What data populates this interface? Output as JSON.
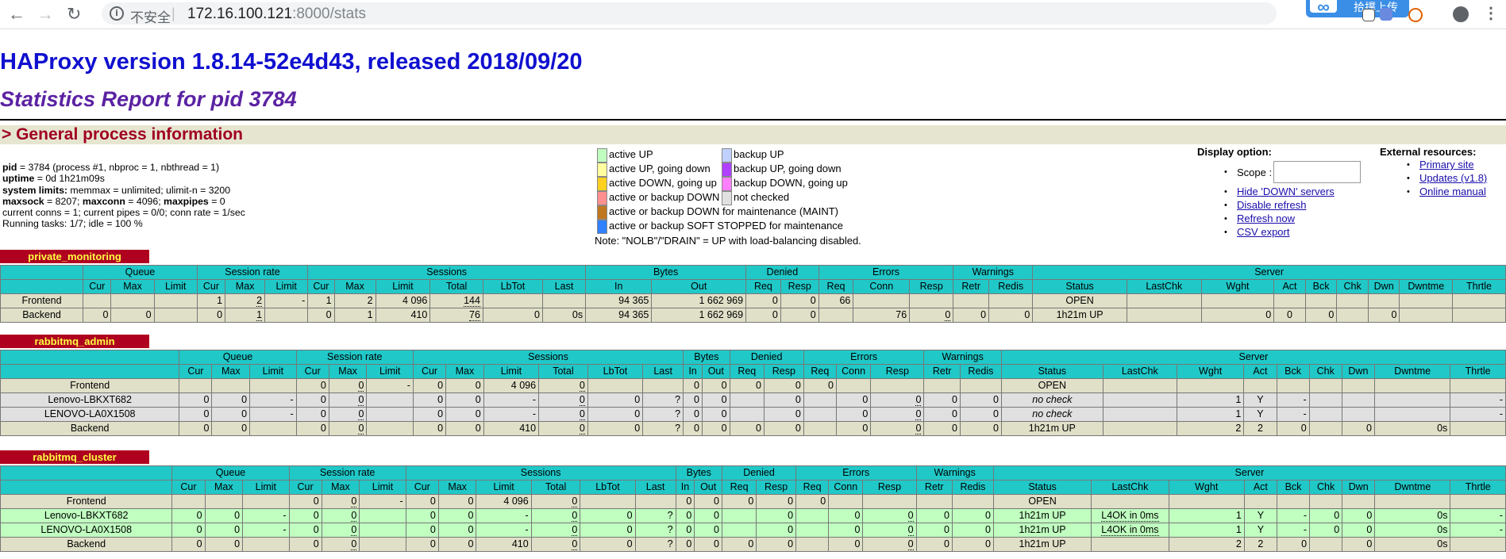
{
  "browser": {
    "security_label": "不安全",
    "url_host": "172.16.100.121",
    "url_rest": ":8000/stats",
    "upload_badge": "拾撲上传"
  },
  "page": {
    "title": "HAProxy version 1.8.14-52e4d43, released 2018/09/20",
    "subtitle": "Statistics Report for pid 3784",
    "section_header": "> General process information"
  },
  "procinfo": {
    "l1_key": "pid",
    "l1_val": " = 3784 (process #1, nbproc = 1, nbthread = 1)",
    "l2_key": "uptime",
    "l2_val": " = 0d 1h21m09s",
    "l3_key": "system limits:",
    "l3_val": " memmax = unlimited; ulimit-n = 3200",
    "l4_key": "maxsock",
    "l4_val": " = 8207; ",
    "l4_key2": "maxconn",
    "l4_val2": " = 4096; ",
    "l4_key3": "maxpipes",
    "l4_val3": " = 0",
    "l5": "current conns = 1; current pipes = 0/0; conn rate = 1/sec",
    "l6": "Running tasks: 1/7; idle = 100 %"
  },
  "legend": {
    "items": [
      {
        "label": "active UP",
        "color": "#c0ffc0"
      },
      {
        "label": "active UP, going down",
        "color": "#ffffa0"
      },
      {
        "label": "active DOWN, going up",
        "color": "#ffd020"
      },
      {
        "label": "active or backup DOWN",
        "color": "#ff9090"
      },
      {
        "label": "active or backup DOWN for maintenance (MAINT)",
        "color": "#c07820"
      },
      {
        "label": "active or backup SOFT STOPPED for maintenance",
        "color": "#3080ff"
      },
      {
        "label": "backup UP",
        "color": "#c0d0ff"
      },
      {
        "label": "backup UP, going down",
        "color": "#b040ff"
      },
      {
        "label": "backup DOWN, going up",
        "color": "#ff80ff"
      },
      {
        "label": "not checked",
        "color": "#e0e0e0"
      }
    ],
    "note": "Note: \"NOLB\"/\"DRAIN\" = UP with load-balancing disabled."
  },
  "display_options": {
    "title": "Display option:",
    "scope_label": "Scope :",
    "scope_value": "",
    "links": [
      "Hide 'DOWN' servers",
      "Disable refresh",
      "Refresh now",
      "CSV export"
    ]
  },
  "external_resources": {
    "title": "External resources:",
    "links": [
      "Primary site",
      "Updates (v1.8)",
      "Online manual"
    ]
  },
  "table_headers": {
    "groups": [
      "Queue",
      "Session rate",
      "Sessions",
      "Bytes",
      "Denied",
      "Errors",
      "Warnings",
      "Server"
    ],
    "cols": [
      "Cur",
      "Max",
      "Limit",
      "Cur",
      "Max",
      "Limit",
      "Cur",
      "Max",
      "Limit",
      "Total",
      "LbTot",
      "Last",
      "In",
      "Out",
      "Req",
      "Resp",
      "Req",
      "Conn",
      "Resp",
      "Retr",
      "Redis",
      "Status",
      "LastChk",
      "Wght",
      "Act",
      "Bck",
      "Chk",
      "Dwn",
      "Dwntme",
      "Thrtle"
    ]
  },
  "proxies": [
    {
      "name": "private_monitoring",
      "rows": [
        {
          "kind": "fe",
          "name": "Frontend",
          "cells": [
            "",
            "",
            "",
            "1",
            "2",
            "-",
            "1",
            "2",
            "4 096",
            "144",
            "",
            "",
            "94 365",
            "1 662 969",
            "0",
            "0",
            "66",
            "",
            "",
            "",
            "",
            "OPEN",
            "",
            "",
            "",
            "",
            "",
            "",
            "",
            ""
          ]
        },
        {
          "kind": "be",
          "name": "Backend",
          "cells": [
            "0",
            "0",
            "",
            "0",
            "1",
            "",
            "0",
            "1",
            "410",
            "76",
            "0",
            "0s",
            "94 365",
            "1 662 969",
            "0",
            "0",
            "",
            "76",
            "0",
            "0",
            "0",
            "1h21m UP",
            "",
            "0",
            "0",
            "0",
            "",
            "0",
            "",
            ""
          ]
        }
      ]
    },
    {
      "name": "rabbitmq_admin",
      "rows": [
        {
          "kind": "fe",
          "name": "Frontend",
          "cells": [
            "",
            "",
            "",
            "0",
            "0",
            "-",
            "0",
            "0",
            "4 096",
            "0",
            "",
            "",
            "0",
            "0",
            "0",
            "0",
            "0",
            "",
            "",
            "",
            "",
            "OPEN",
            "",
            "",
            "",
            "",
            "",
            "",
            "",
            ""
          ]
        },
        {
          "kind": "down",
          "name": "Lenovo-LBKXT682",
          "cells": [
            "0",
            "0",
            "-",
            "0",
            "0",
            "",
            "0",
            "0",
            "-",
            "0",
            "0",
            "?",
            "0",
            "0",
            "",
            "0",
            "",
            "0",
            "0",
            "0",
            "0",
            "no check",
            "",
            "1",
            "Y",
            "-",
            "",
            "",
            "",
            "-"
          ]
        },
        {
          "kind": "down",
          "name": "LENOVO-LA0X1508",
          "cells": [
            "0",
            "0",
            "-",
            "0",
            "0",
            "",
            "0",
            "0",
            "-",
            "0",
            "0",
            "?",
            "0",
            "0",
            "",
            "0",
            "",
            "0",
            "0",
            "0",
            "0",
            "no check",
            "",
            "1",
            "Y",
            "-",
            "",
            "",
            "",
            "-"
          ]
        },
        {
          "kind": "be",
          "name": "Backend",
          "cells": [
            "0",
            "0",
            "",
            "0",
            "0",
            "",
            "0",
            "0",
            "410",
            "0",
            "0",
            "?",
            "0",
            "0",
            "0",
            "0",
            "",
            "0",
            "0",
            "0",
            "0",
            "1h21m UP",
            "",
            "2",
            "2",
            "0",
            "",
            "0",
            "0s",
            ""
          ]
        }
      ]
    },
    {
      "name": "rabbitmq_cluster",
      "rows": [
        {
          "kind": "fe",
          "name": "Frontend",
          "cells": [
            "",
            "",
            "",
            "0",
            "0",
            "-",
            "0",
            "0",
            "4 096",
            "0",
            "",
            "",
            "0",
            "0",
            "0",
            "0",
            "0",
            "",
            "",
            "",
            "",
            "OPEN",
            "",
            "",
            "",
            "",
            "",
            "",
            "",
            ""
          ]
        },
        {
          "kind": "up",
          "name": "Lenovo-LBKXT682",
          "cells": [
            "0",
            "0",
            "-",
            "0",
            "0",
            "",
            "0",
            "0",
            "-",
            "0",
            "0",
            "?",
            "0",
            "0",
            "",
            "0",
            "",
            "0",
            "0",
            "0",
            "0",
            "1h21m UP",
            "L4OK in 0ms",
            "1",
            "Y",
            "-",
            "0",
            "0",
            "0s",
            "-"
          ]
        },
        {
          "kind": "up",
          "name": "LENOVO-LA0X1508",
          "cells": [
            "0",
            "0",
            "-",
            "0",
            "0",
            "",
            "0",
            "0",
            "-",
            "0",
            "0",
            "?",
            "0",
            "0",
            "",
            "0",
            "",
            "0",
            "0",
            "0",
            "0",
            "1h21m UP",
            "L4OK in 0ms",
            "1",
            "Y",
            "-",
            "0",
            "0",
            "0s",
            "-"
          ]
        },
        {
          "kind": "be",
          "name": "Backend",
          "cells": [
            "0",
            "0",
            "",
            "0",
            "0",
            "",
            "0",
            "0",
            "410",
            "0",
            "0",
            "?",
            "0",
            "0",
            "0",
            "0",
            "",
            "0",
            "0",
            "0",
            "0",
            "1h21m UP",
            "",
            "2",
            "2",
            "0",
            "",
            "0",
            "0s",
            ""
          ]
        }
      ]
    }
  ]
}
